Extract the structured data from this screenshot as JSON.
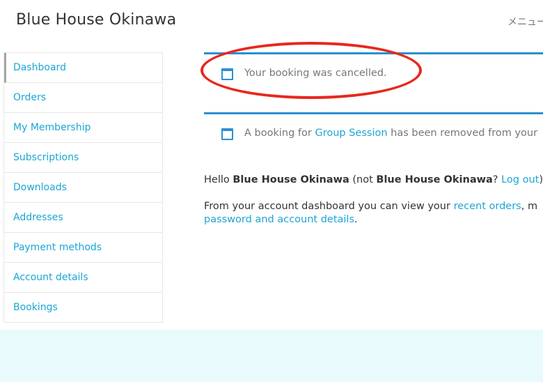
{
  "header": {
    "site_title": "Blue House Okinawa",
    "menu_label": "メニュー"
  },
  "sidebar": {
    "items": [
      {
        "label": "Dashboard",
        "active": true
      },
      {
        "label": "Orders"
      },
      {
        "label": "My Membership"
      },
      {
        "label": "Subscriptions"
      },
      {
        "label": "Downloads"
      },
      {
        "label": "Addresses"
      },
      {
        "label": "Payment methods"
      },
      {
        "label": "Account details"
      },
      {
        "label": "Bookings"
      }
    ]
  },
  "notices": {
    "cancelled": {
      "text": "Your booking was cancelled."
    },
    "removed": {
      "prefix": "A booking for ",
      "link": "Group Session",
      "suffix": " has been removed from your"
    }
  },
  "greeting": {
    "hello": "Hello ",
    "name": "Blue House Okinawa",
    "not_open": " (not ",
    "not_name": "Blue House Okinawa",
    "question": "? ",
    "logout": "Log out",
    "close": ")"
  },
  "intro": {
    "line1_prefix": "From your account dashboard you can view your ",
    "recent_orders": "recent orders",
    "line1_suffix": ", m",
    "account_details_link": "password and account details",
    "period": "."
  },
  "colors": {
    "link": "#1ba6d6",
    "notice_border": "#2b8fcf",
    "annotation": "#e8271d",
    "footer_band": "#e9fafd"
  }
}
